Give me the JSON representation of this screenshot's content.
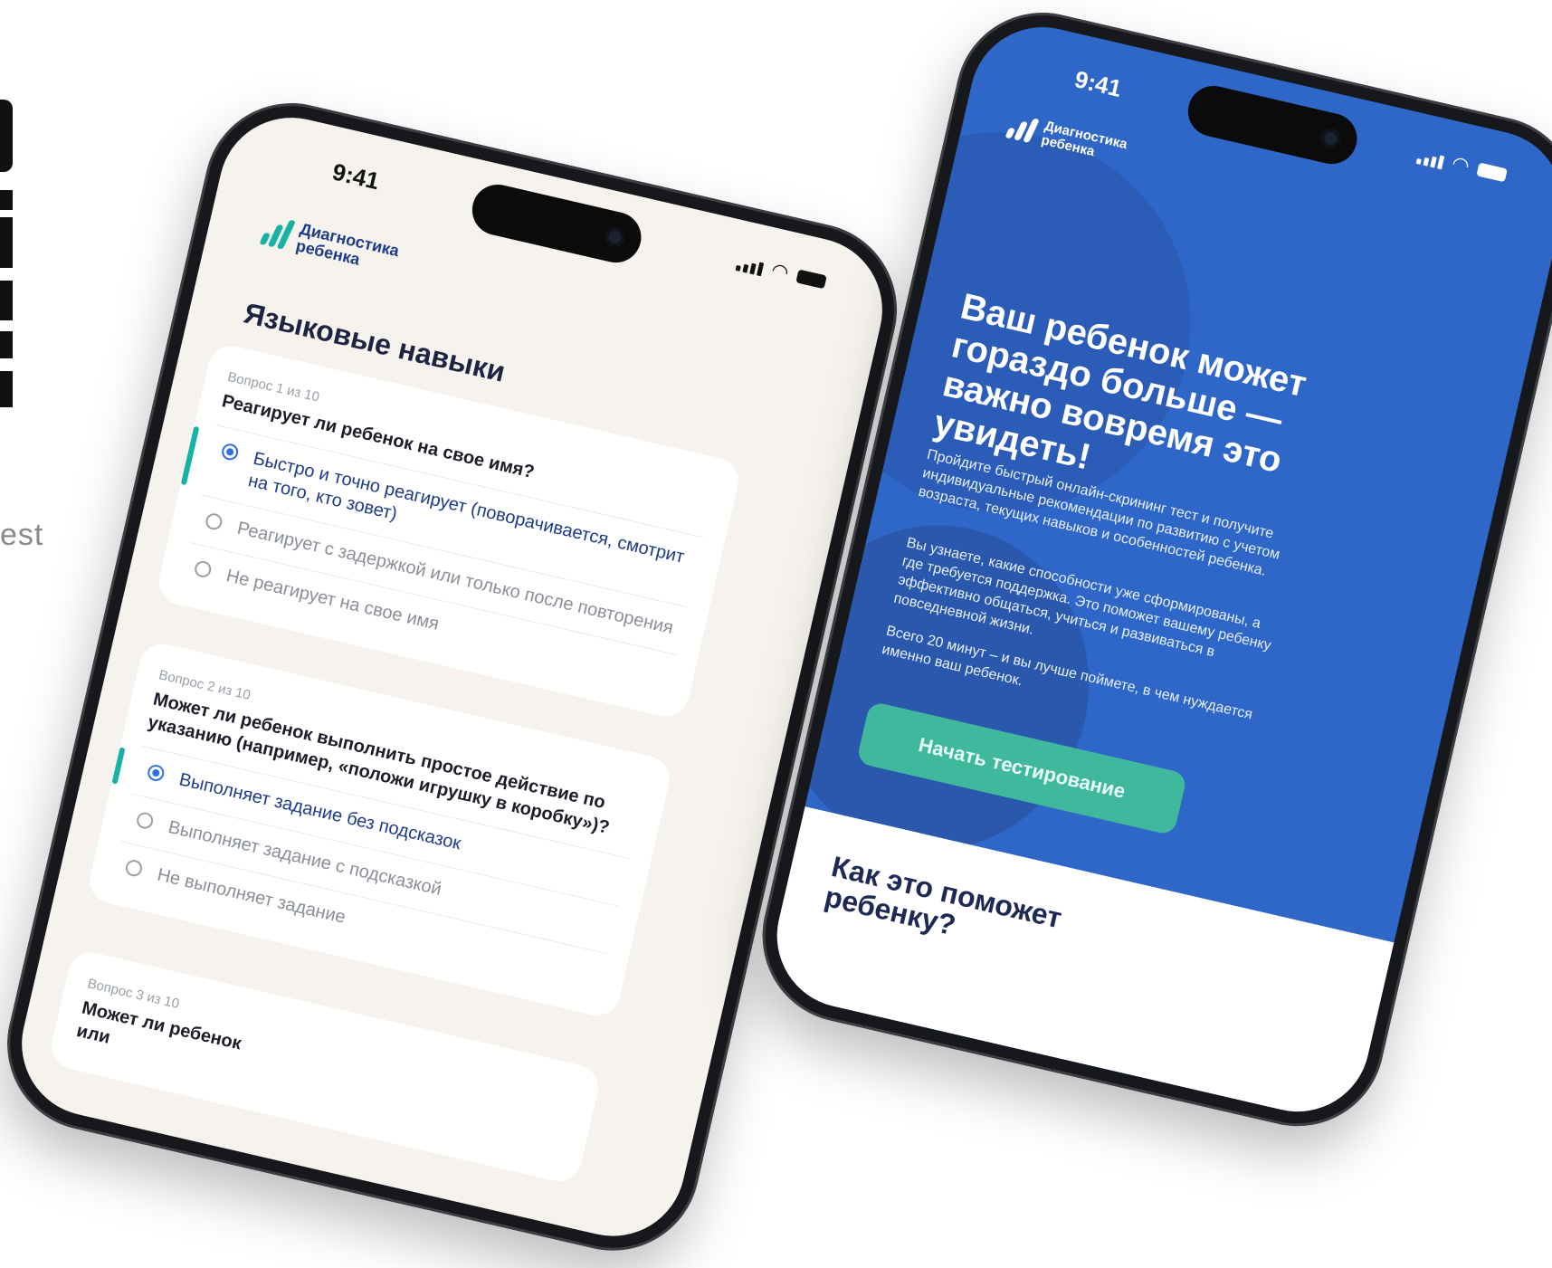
{
  "left_edge": {
    "word": "est"
  },
  "phone_left": {
    "status": {
      "time": "9:41"
    },
    "brand": {
      "name_line1": "Диагностика",
      "name_line2": "ребенка"
    },
    "section_title": "Языковые навыки",
    "questions": [
      {
        "number": "Вопрос 1 из 10",
        "text": "Реагирует ли ребенок на свое имя?",
        "options": [
          "Быстро и точно реагирует (поворачивается, смотрит на того, кто зовет)",
          "Реагирует с задержкой или только после повторения",
          "Не реагирует на свое имя"
        ],
        "selected_index": 0
      },
      {
        "number": "Вопрос 2 из 10",
        "text": "Может ли ребенок выполнить простое действие по указанию (например, «положи игрушку в коробку»)?",
        "options": [
          "Выполняет задание без подсказок",
          "Выполняет задание с подсказкой",
          "Не выполняет задание"
        ],
        "selected_index": 0
      },
      {
        "number": "Вопрос 3 из 10",
        "text_fragment": "Может ли ребенок",
        "text_fragment_2": "или"
      }
    ]
  },
  "phone_right": {
    "status": {
      "time": "9:41"
    },
    "brand": {
      "name_line1": "Диагностика",
      "name_line2": "ребенка"
    },
    "hero_title": "Ваш ребенок может гораздо больше — важно вовремя это увидеть!",
    "paragraphs": [
      "Пройдите быстрый онлайн-скрининг тест и получите индивидуальные рекомендации по развитию с учетом возраста, текущих навыков и особенностей ребенка.",
      "Вы узнаете, какие способности уже сформированы, а где требуется поддержка. Это поможет вашему ребенку эффективно общаться, учиться и развиваться в повседневной жизни.",
      "Всего 20 минут – и вы лучше поймете, в чем нуждается именно ваш ребенок."
    ],
    "cta_label": "Начать тестирование",
    "how_title": "Как это поможет ребенку?"
  },
  "colors": {
    "accent_teal": "#16b2a4",
    "brand_blue": "#1d3b8a",
    "hero_blue": "#2f67c9",
    "cta_green": "#3fb89e"
  }
}
